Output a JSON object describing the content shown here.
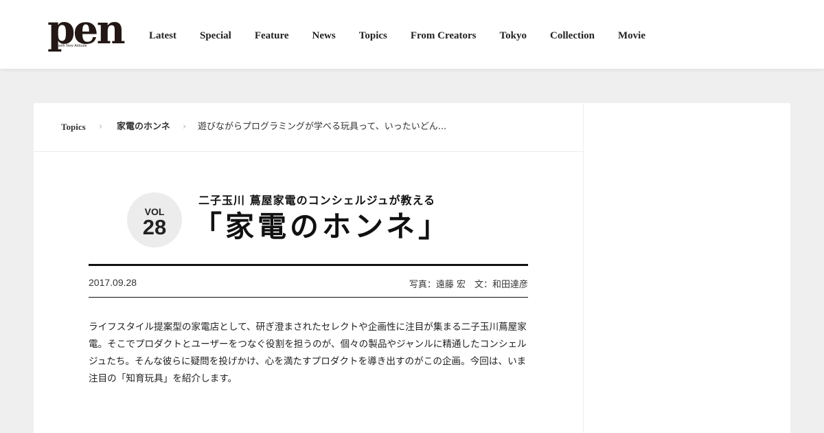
{
  "header": {
    "logo": "pen",
    "logo_tagline": "with New Attitude",
    "nav": [
      "Latest",
      "Special",
      "Feature",
      "News",
      "Topics",
      "From Creators",
      "Tokyo",
      "Collection",
      "Movie"
    ]
  },
  "breadcrumb": {
    "items": [
      "Topics",
      "家電のホンネ",
      "遊びながらプログラミングが学べる玩具って、いったいどん..."
    ],
    "separator": "›"
  },
  "article": {
    "vol_label": "VOL",
    "vol_number": "28",
    "subtitle": "二子玉川 蔦屋家電のコンシェルジュが教える",
    "title": "「家電のホンネ」",
    "date": "2017.09.28",
    "credits": "写真：遠藤 宏　文：和田達彦",
    "intro": "ライフスタイル提案型の家電店として、研ぎ澄まされたセレクトや企画性に注目が集まる二子玉川蔦屋家電。そこでプロダクトとユーザーをつなぐ役割を担うのが、個々の製品やジャンルに精通したコンシェルジュたち。そんな彼らに疑問を投げかけ、心を満たすプロダクトを導き出すのがこの企画。今回は、いま注目の「知育玩具」を紹介します。"
  },
  "colors": {
    "page_bg": "#efefef",
    "card_bg": "#ffffff",
    "text": "#222222",
    "badge_bg": "#ececec"
  }
}
